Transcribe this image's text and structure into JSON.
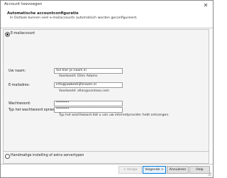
{
  "window": {
    "title": "Account toevoegen",
    "close_glyph": "✕"
  },
  "header": {
    "title": "Automatische accountconfiguratie",
    "subtitle": "In Outlook kunnen veel e-mailaccounts automatisch worden geconfigureerd."
  },
  "options": {
    "email_account": {
      "label": "E-mailaccount",
      "selected": true
    },
    "manual_setup": {
      "label": "Handmatige instelling of extra servertypen",
      "selected": false
    }
  },
  "form": {
    "name": {
      "label": "Uw naam:",
      "value": "Vul hier je naam in",
      "example": "Voorbeeld: Ellen Adams"
    },
    "email": {
      "label": "E-mailadres:",
      "value": "info@jowbedrijfsnaam.nl",
      "example": "Voorbeeld: ellen@contoso.com"
    },
    "password": {
      "label": "Wachtwoord:",
      "value": "********"
    },
    "password_confirm": {
      "label": "Typ het wachtwoord opnieuw:",
      "value": "********",
      "hint": "Typ het wachtwoord dat u van uw internetprovider hebt ontvangen."
    }
  },
  "buttons": {
    "back": "< Vorige",
    "next": "Volgende >",
    "cancel": "Annuleren",
    "help": "Help"
  },
  "icons": {
    "close": "close-icon",
    "radio": "radio-icon",
    "grip": "resize-grip-icon"
  }
}
